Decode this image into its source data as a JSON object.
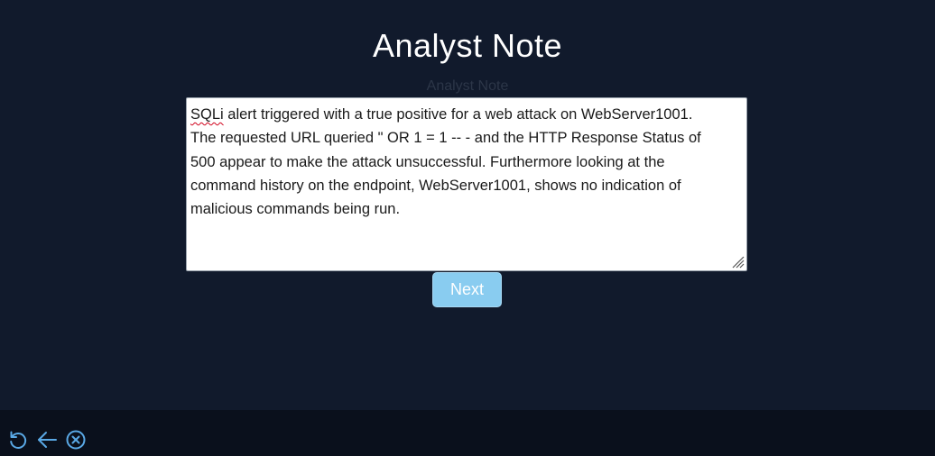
{
  "page": {
    "title": "Analyst Note",
    "field_label": "Analyst Note"
  },
  "note": {
    "first_word": "SQLi",
    "text_rest": " alert triggered with a true positive for a web attack on WebServer1001.\nThe requested URL queried \" OR 1 = 1 -- - and the HTTP Response Status of\n500 appear to make the attack unsuccessful. Furthermore looking at the\ncommand history on the endpoint, WebServer1001, shows no indication of\nmalicious commands being run."
  },
  "actions": {
    "next_label": "Next"
  },
  "footer": {
    "icons": [
      "refresh-icon",
      "back-arrow-icon",
      "close-circle-icon"
    ],
    "icon_color": "#5aa9e6"
  },
  "colors": {
    "background": "#111a2c",
    "footer_background": "#0a101c",
    "accent_button": "#89ccf0"
  }
}
